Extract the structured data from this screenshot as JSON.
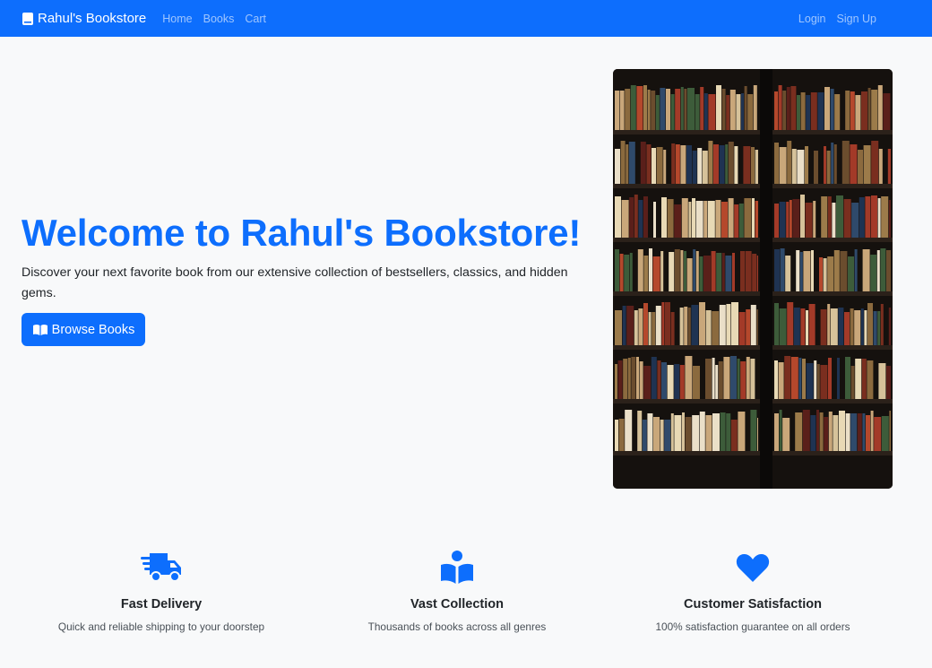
{
  "navbar": {
    "brand": "Rahul's Bookstore",
    "links": [
      "Home",
      "Books",
      "Cart"
    ],
    "right_links": [
      "Login",
      "Sign Up"
    ],
    "bg_color": "#0d6efd"
  },
  "hero": {
    "title": "Welcome to Rahul's Bookstore!",
    "lead": "Discover your next favorite book from our extensive collection of bestsellers, classics, and hidden gems.",
    "button_label": "Browse Books",
    "button_icon": "open-book-icon",
    "image": "bookshelf-photo"
  },
  "features": [
    {
      "icon": "truck-icon",
      "title": "Fast Delivery",
      "text": "Quick and reliable shipping to your doorstep"
    },
    {
      "icon": "reader-icon",
      "title": "Vast Collection",
      "text": "Thousands of books across all genres"
    },
    {
      "icon": "heart-icon",
      "title": "Customer Satisfaction",
      "text": "100% satisfaction guarantee on all orders"
    }
  ],
  "accent_color": "#0d6efd"
}
